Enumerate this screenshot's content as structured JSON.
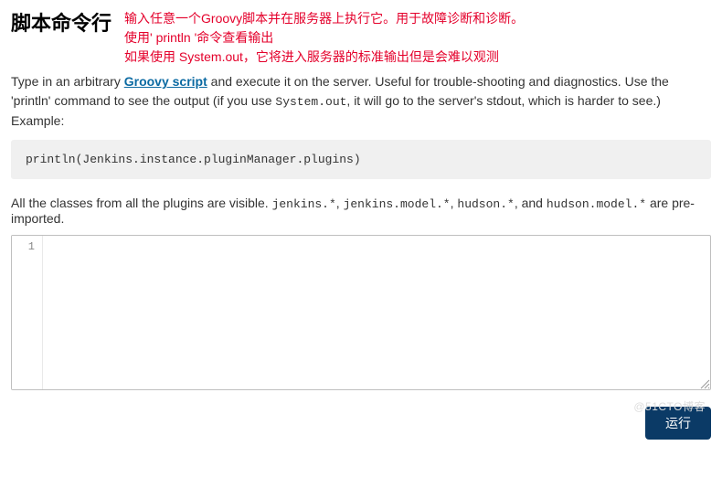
{
  "header": {
    "title": "脚本命令行",
    "red_note_line1": "输入任意一个Groovy脚本并在服务器上执行它。用于故障诊断和诊断。",
    "red_note_line2": "使用' println '命令查看输出",
    "red_note_line3": "如果使用 System.out，它将进入服务器的标准输出但是会难以观测"
  },
  "description": {
    "prefix": "Type in an arbitrary ",
    "link_text": "Groovy script",
    "middle": " and execute it on the server. Useful for trouble-shooting and diagnostics. Use the 'println' command to see the output (if you use ",
    "code_sysout": "System.out",
    "suffix": ", it will go to the server's stdout, which is harder to see.) Example:"
  },
  "example_code": "println(Jenkins.instance.pluginManager.plugins)",
  "classes_note": {
    "prefix": "All the classes from all the plugins are visible. ",
    "c1": "jenkins.*",
    "sep1": ", ",
    "c2": "jenkins.model.*",
    "sep2": ", ",
    "c3": "hudson.*",
    "sep3": ", and ",
    "c4": "hudson.model.*",
    "suffix": " are pre-imported."
  },
  "editor": {
    "line_number": "1",
    "content": ""
  },
  "run_button": "运行",
  "watermark": "@51CTO博客"
}
